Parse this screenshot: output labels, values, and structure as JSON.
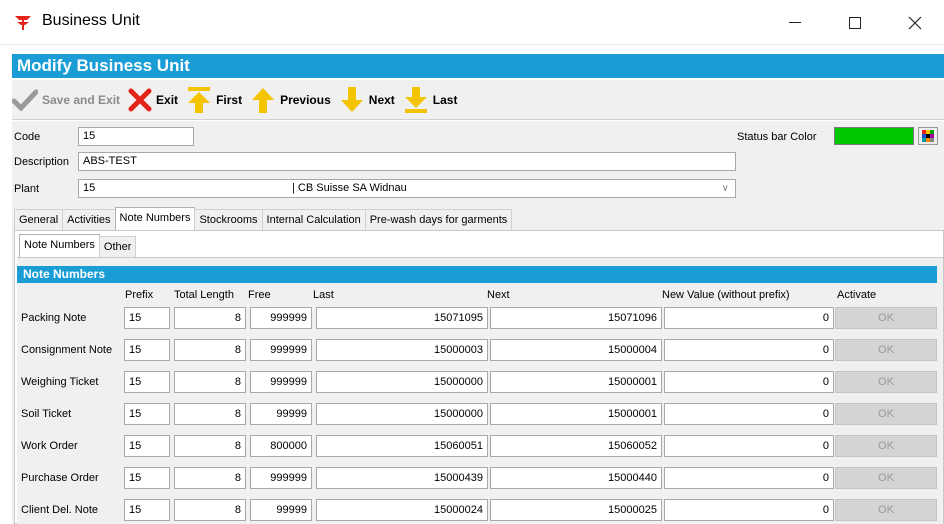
{
  "window": {
    "title": "Business Unit",
    "icon": "app-logo-icon"
  },
  "header": {
    "title": "Modify Business Unit"
  },
  "toolbar": {
    "save_exit": "Save and Exit",
    "exit": "Exit",
    "first": "First",
    "previous": "Previous",
    "next": "Next",
    "last": "Last"
  },
  "form": {
    "code_label": "Code",
    "code_value": "15",
    "description_label": "Description",
    "description_value": "ABS-TEST",
    "plant_label": "Plant",
    "plant_code": "15",
    "plant_name": "| CB Suisse SA Widnau",
    "status_bar_color_label": "Status bar Color",
    "status_bar_color": "#00c800"
  },
  "tabs": [
    "General",
    "Activities",
    "Note Numbers",
    "Stockrooms",
    "Internal Calculation",
    "Pre-wash days for garments"
  ],
  "subtabs": [
    "Note Numbers",
    "Other"
  ],
  "note_numbers": {
    "section_title": "Note Numbers",
    "columns": {
      "prefix": "Prefix",
      "total_length": "Total Length",
      "free": "Free",
      "last": "Last",
      "next": "Next",
      "new_value": "New Value (without prefix)",
      "activate": "Activate"
    },
    "rows": [
      {
        "label": "Packing Note",
        "prefix": "15",
        "total_length": "8",
        "free": "999999",
        "last": "15071095",
        "next": "15071096",
        "new_value": "0",
        "activate": "OK"
      },
      {
        "label": "Consignment Note",
        "prefix": "15",
        "total_length": "8",
        "free": "999999",
        "last": "15000003",
        "next": "15000004",
        "new_value": "0",
        "activate": "OK"
      },
      {
        "label": "Weighing Ticket",
        "prefix": "15",
        "total_length": "8",
        "free": "999999",
        "last": "15000000",
        "next": "15000001",
        "new_value": "0",
        "activate": "OK"
      },
      {
        "label": "Soil Ticket",
        "prefix": "15",
        "total_length": "8",
        "free": "99999",
        "last": "15000000",
        "next": "15000001",
        "new_value": "0",
        "activate": "OK"
      },
      {
        "label": "Work Order",
        "prefix": "15",
        "total_length": "8",
        "free": "800000",
        "last": "15060051",
        "next": "15060052",
        "new_value": "0",
        "activate": "OK"
      },
      {
        "label": "Purchase Order",
        "prefix": "15",
        "total_length": "8",
        "free": "999999",
        "last": "15000439",
        "next": "15000440",
        "new_value": "0",
        "activate": "OK"
      },
      {
        "label": "Client Del. Note",
        "prefix": "15",
        "total_length": "8",
        "free": "99999",
        "last": "15000024",
        "next": "15000025",
        "new_value": "0",
        "activate": "OK"
      }
    ]
  },
  "colors": {
    "accent": "#1a9dd5",
    "arrow": "#f5c400",
    "exit": "#e4231a"
  }
}
